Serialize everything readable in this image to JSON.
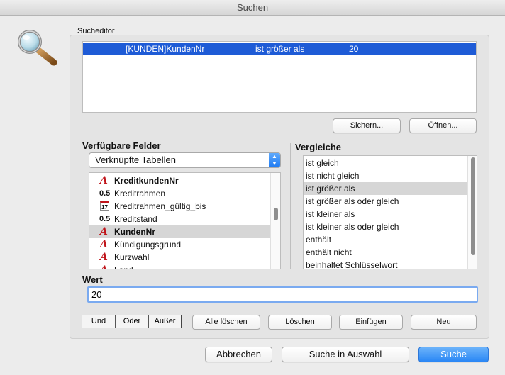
{
  "window": {
    "title": "Suchen"
  },
  "icons": {
    "app": "magnifier-icon"
  },
  "editor": {
    "label": "Sucheditor",
    "row": {
      "field": "[KUNDEN]KundenNr",
      "operator": "ist größer als",
      "value": "20"
    },
    "save_label": "Sichern...",
    "open_label": "Öffnen..."
  },
  "fields": {
    "label": "Verfügbare Felder",
    "dropdown_value": "Verknüpfte Tabellen",
    "items": [
      {
        "icon": "A",
        "label": "KreditkundenNr",
        "bold": true,
        "selected": false
      },
      {
        "icon": "0.5",
        "label": "Kreditrahmen",
        "bold": false,
        "selected": false
      },
      {
        "icon": "17",
        "label": "Kreditrahmen_gültig_bis",
        "bold": false,
        "selected": false
      },
      {
        "icon": "0.5",
        "label": "Kreditstand",
        "bold": false,
        "selected": false
      },
      {
        "icon": "A",
        "label": "KundenNr",
        "bold": true,
        "selected": true
      },
      {
        "icon": "A",
        "label": "Kündigungsgrund",
        "bold": false,
        "selected": false
      },
      {
        "icon": "A",
        "label": "Kurzwahl",
        "bold": false,
        "selected": false
      },
      {
        "icon": "A",
        "label": "Land",
        "bold": false,
        "selected": false
      }
    ]
  },
  "comparisons": {
    "label": "Vergleiche",
    "items": [
      {
        "label": "ist gleich",
        "selected": false
      },
      {
        "label": "ist nicht gleich",
        "selected": false
      },
      {
        "label": "ist größer als",
        "selected": true
      },
      {
        "label": "ist größer als oder gleich",
        "selected": false
      },
      {
        "label": "ist kleiner als",
        "selected": false
      },
      {
        "label": "ist kleiner als oder gleich",
        "selected": false
      },
      {
        "label": "enthält",
        "selected": false
      },
      {
        "label": "enthält nicht",
        "selected": false
      },
      {
        "label": "beinhaltet Schlüsselwort",
        "selected": false
      }
    ]
  },
  "value": {
    "label": "Wert",
    "current": "20"
  },
  "logic": {
    "and": "Und",
    "or": "Oder",
    "except": "Außer"
  },
  "actions": {
    "clear_all": "Alle löschen",
    "delete": "Löschen",
    "insert": "Einfügen",
    "new": "Neu"
  },
  "footer": {
    "cancel": "Abbrechen",
    "search_in_selection": "Suche in Auswahl",
    "search": "Suche"
  },
  "colors": {
    "selection": "#1e5bd6",
    "accent": "#2a87f5",
    "field_icon": "#c0141a"
  }
}
